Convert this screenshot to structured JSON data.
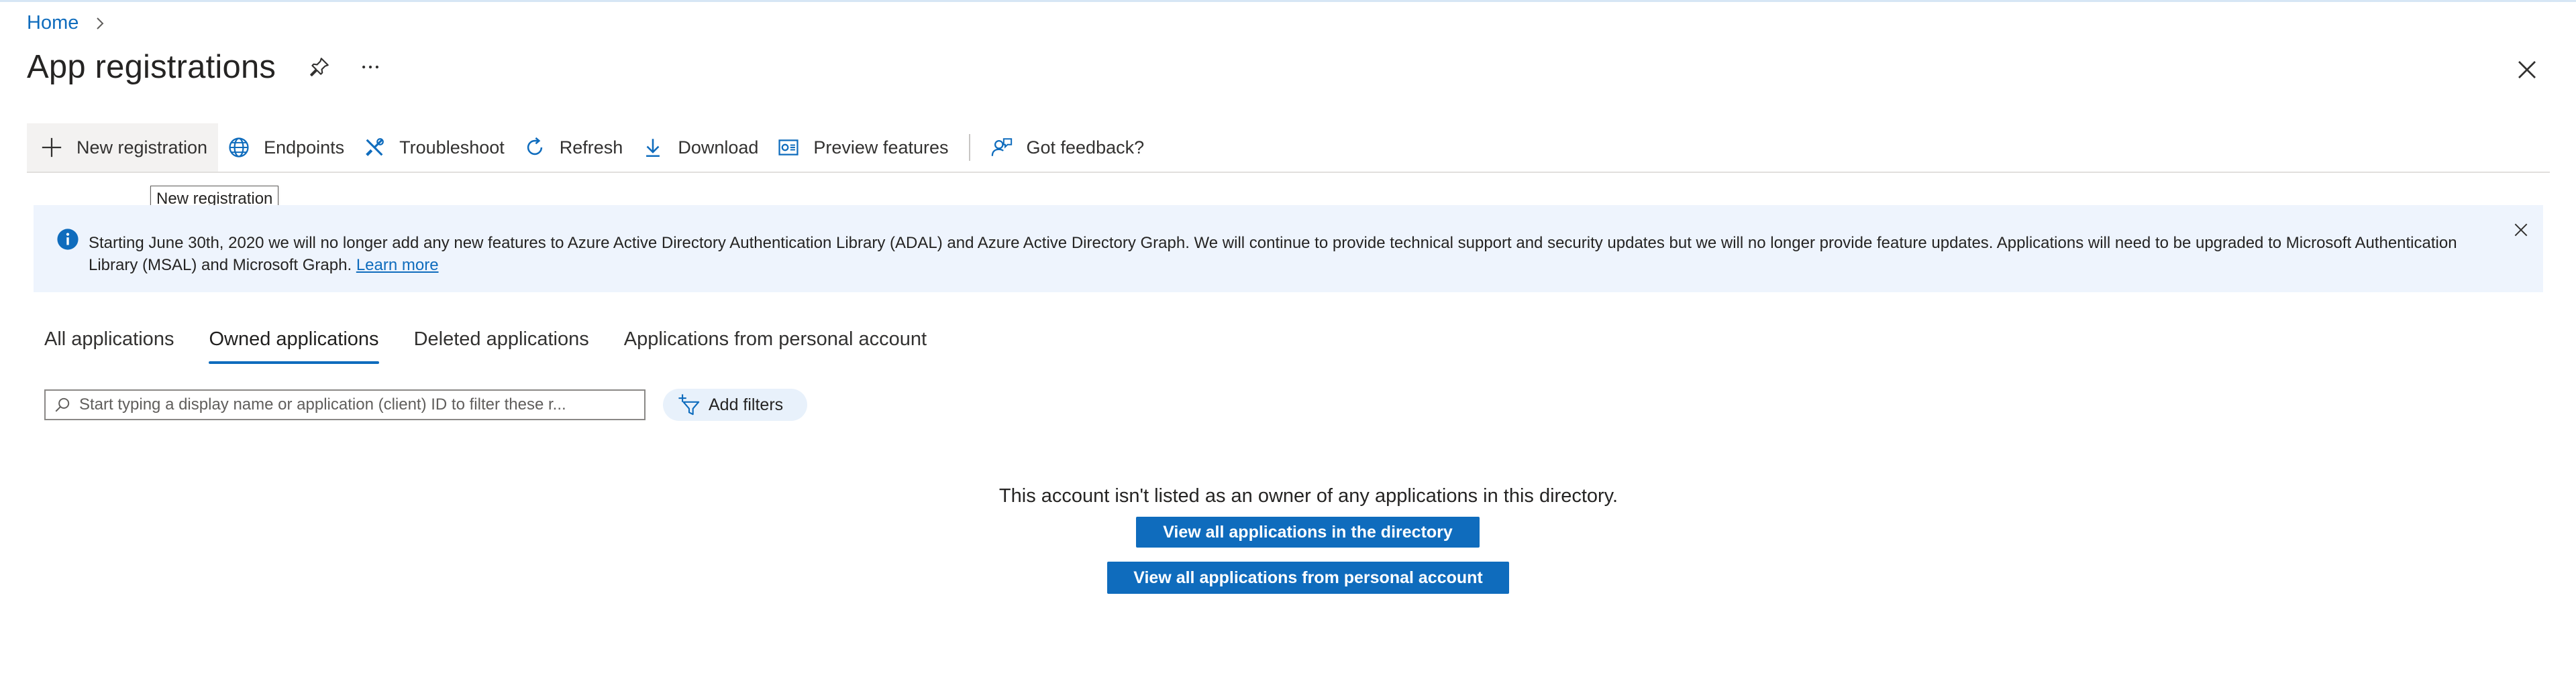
{
  "breadcrumb": {
    "home": "Home"
  },
  "page": {
    "title": "App registrations"
  },
  "toolbar": {
    "new_registration": "New registration",
    "endpoints": "Endpoints",
    "troubleshoot": "Troubleshoot",
    "refresh": "Refresh",
    "download": "Download",
    "preview_features": "Preview features",
    "got_feedback": "Got feedback?"
  },
  "tooltip": {
    "text": "New registration"
  },
  "banner": {
    "message": "Starting June 30th, 2020 we will no longer add any new features to Azure Active Directory Authentication Library (ADAL) and Azure Active Directory Graph. We will continue to provide technical support and security updates but we will no longer provide feature updates. Applications will need to be upgraded to Microsoft Authentication Library (MSAL) and Microsoft Graph.",
    "link": "Learn more"
  },
  "tabs": [
    {
      "label": "All applications"
    },
    {
      "label": "Owned applications"
    },
    {
      "label": "Deleted applications"
    },
    {
      "label": "Applications from personal account"
    }
  ],
  "search": {
    "placeholder": "Start typing a display name or application (client) ID to filter these r..."
  },
  "filters": {
    "add_label": "Add filters"
  },
  "empty": {
    "message": "This account isn't listed as an owner of any applications in this directory.",
    "view_directory": "View all applications in the directory",
    "view_personal": "View all applications from personal account"
  },
  "colors": {
    "accent": "#0f6cbd",
    "banner_bg": "#eef4fd",
    "filter_pill_bg": "#e8f1fb"
  },
  "icons": [
    "chevron-right-icon",
    "pin-icon",
    "more-icon",
    "close-icon",
    "plus-icon",
    "globe-icon",
    "wrench-icon",
    "refresh-icon",
    "download-icon",
    "preview-icon",
    "feedback-icon",
    "info-icon",
    "search-icon",
    "filter-add-icon"
  ]
}
